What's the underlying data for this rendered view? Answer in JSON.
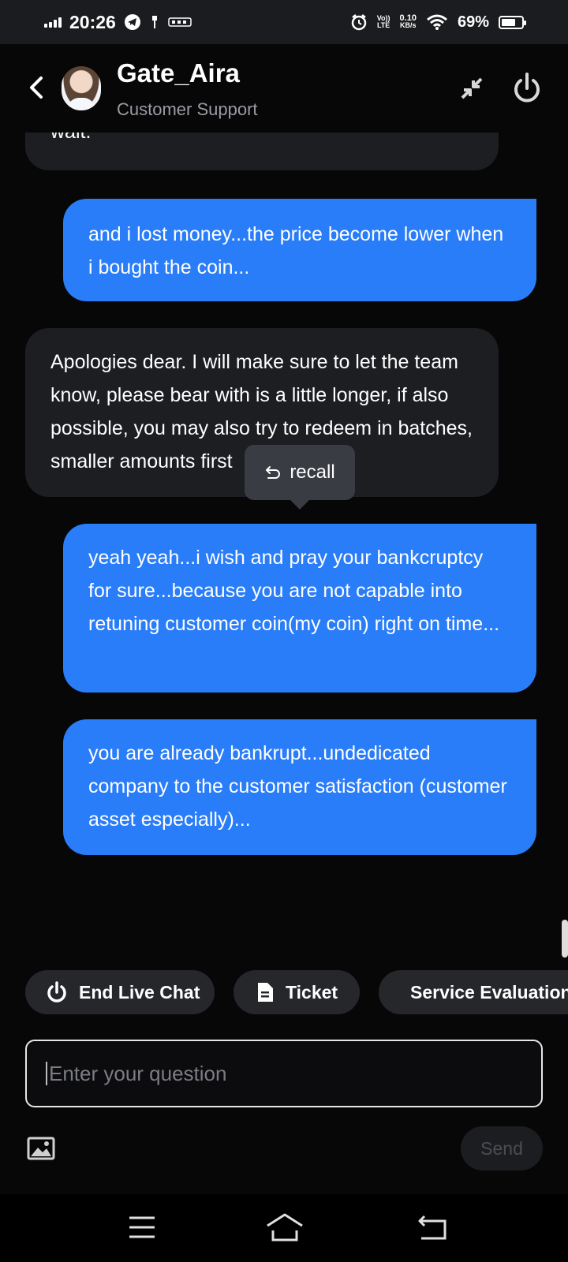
{
  "status_bar": {
    "time": "20:26",
    "volte_top": "Vo))",
    "volte_bottom": "LTE",
    "speed_value": "0.10",
    "speed_unit": "KB/s",
    "battery_percent": "69%",
    "battery_level": 0.69
  },
  "header": {
    "agent_name": "Gate_Aira",
    "agent_role": "Customer Support"
  },
  "messages": [
    {
      "sender": "agent",
      "text": "wait."
    },
    {
      "sender": "user",
      "text": "and i lost money...the price become lower when i bought the coin..."
    },
    {
      "sender": "agent",
      "text": "Apologies dear. I will make sure to let the team know, please bear with is a little longer, if also possible, you may also try to redeem in batches, smaller amounts first"
    },
    {
      "sender": "user",
      "text": "yeah yeah...i wish and pray your bankcruptcy for sure...because you are not capable into retuning customer coin(my coin) right on time..."
    },
    {
      "sender": "user",
      "text": "you are already bankrupt...undedicated company to the customer satisfaction (customer asset especially)..."
    }
  ],
  "recall_popup": {
    "label": "recall"
  },
  "quick_actions": {
    "end_chat": "End Live Chat",
    "ticket": "Ticket",
    "service_evaluation": "Service Evaluation"
  },
  "composer": {
    "placeholder": "Enter your question",
    "send_label": "Send"
  },
  "colors": {
    "user_bubble": "#2a7df8",
    "agent_bubble": "#1d1e22",
    "background": "#070708"
  }
}
